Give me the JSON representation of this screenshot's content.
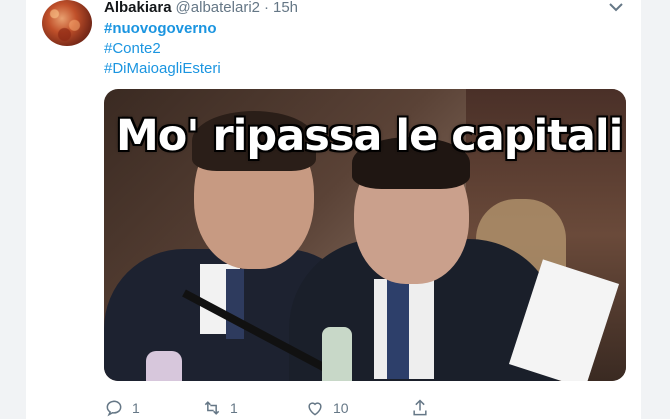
{
  "tweet": {
    "author_name": "Albakiara",
    "author_handle": "@albatelari2",
    "separator": "·",
    "time": "15h",
    "hashtags": [
      "#nuovogoverno",
      "#Conte2",
      "#DiMaioagliEsteri"
    ],
    "media_caption": "Mo' ripassa le capitali",
    "stats": {
      "replies": "1",
      "retweets": "1",
      "likes": "10"
    }
  },
  "colors": {
    "link": "#1b95e0",
    "text": "#14171a",
    "muted": "#657786",
    "background": "#f1f3f5"
  },
  "icons": {
    "caret": "chevron-down-icon",
    "reply": "reply-icon",
    "retweet": "retweet-icon",
    "like": "heart-icon",
    "share": "share-icon"
  }
}
